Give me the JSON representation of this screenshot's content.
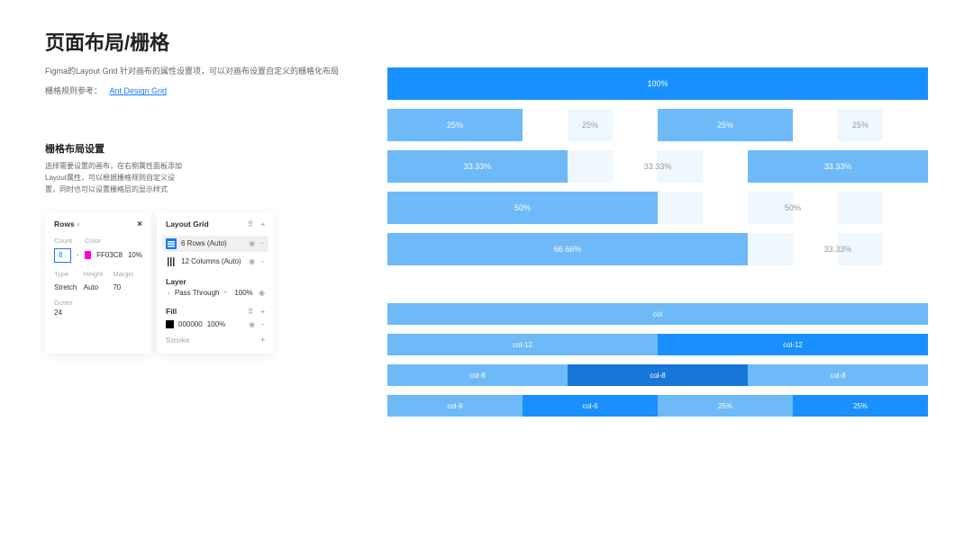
{
  "page": {
    "title": "页面布局/栅格",
    "description": "Figma的Layout Grid 针对画布的属性设置项，可以对画布设置自定义的栅格化布局",
    "ref_label": "栅格规则参考：",
    "ref_link_text": "Ant Design Grid"
  },
  "section": {
    "title": "栅格布局设置",
    "desc": "选择需要设置的画布，在右侧属性面板添加Layout属性，可以根据栅格规则自定义设置，同时也可以设置栅格层的显示样式"
  },
  "rows_panel": {
    "title": "Rows",
    "count_label": "Count",
    "count_value": "8",
    "color_label": "Color",
    "color_hex": "FF03C8",
    "color_opacity": "10%",
    "type_label": "Type",
    "type_value": "Stretch",
    "height_label": "Height",
    "height_value": "Auto",
    "margin_label": "Margin",
    "margin_value": "70",
    "gutter_label": "Gutter",
    "gutter_value": "24"
  },
  "layout_panel": {
    "title": "Layout Grid",
    "item1": "6 Rows (Auto)",
    "item2": "12 Columns (Auto)",
    "layer_title": "Layer",
    "blend_mode": "Pass Through",
    "blend_opacity": "100%",
    "fill_title": "Fill",
    "fill_hex": "000000",
    "fill_opacity": "100%",
    "stroke_title": "Stroke"
  },
  "grid": {
    "r1": "100%",
    "r2a": "25%",
    "r2b": "25%",
    "r2c": "25%",
    "r2d": "25%",
    "r3a": "33.33%",
    "r3b": "33.33%",
    "r3c": "33.33%",
    "r4a": "50%",
    "r4b": "50%",
    "r5a": "66.66%",
    "r5b": "33.33%",
    "r6": "col",
    "r7a": "col-12",
    "r7b": "col-12",
    "r8a": "col-8",
    "r8b": "col-8",
    "r8c": "col-8",
    "r9a": "col-6",
    "r9b": "col-6",
    "r9c": "25%",
    "r9d": "25%"
  }
}
